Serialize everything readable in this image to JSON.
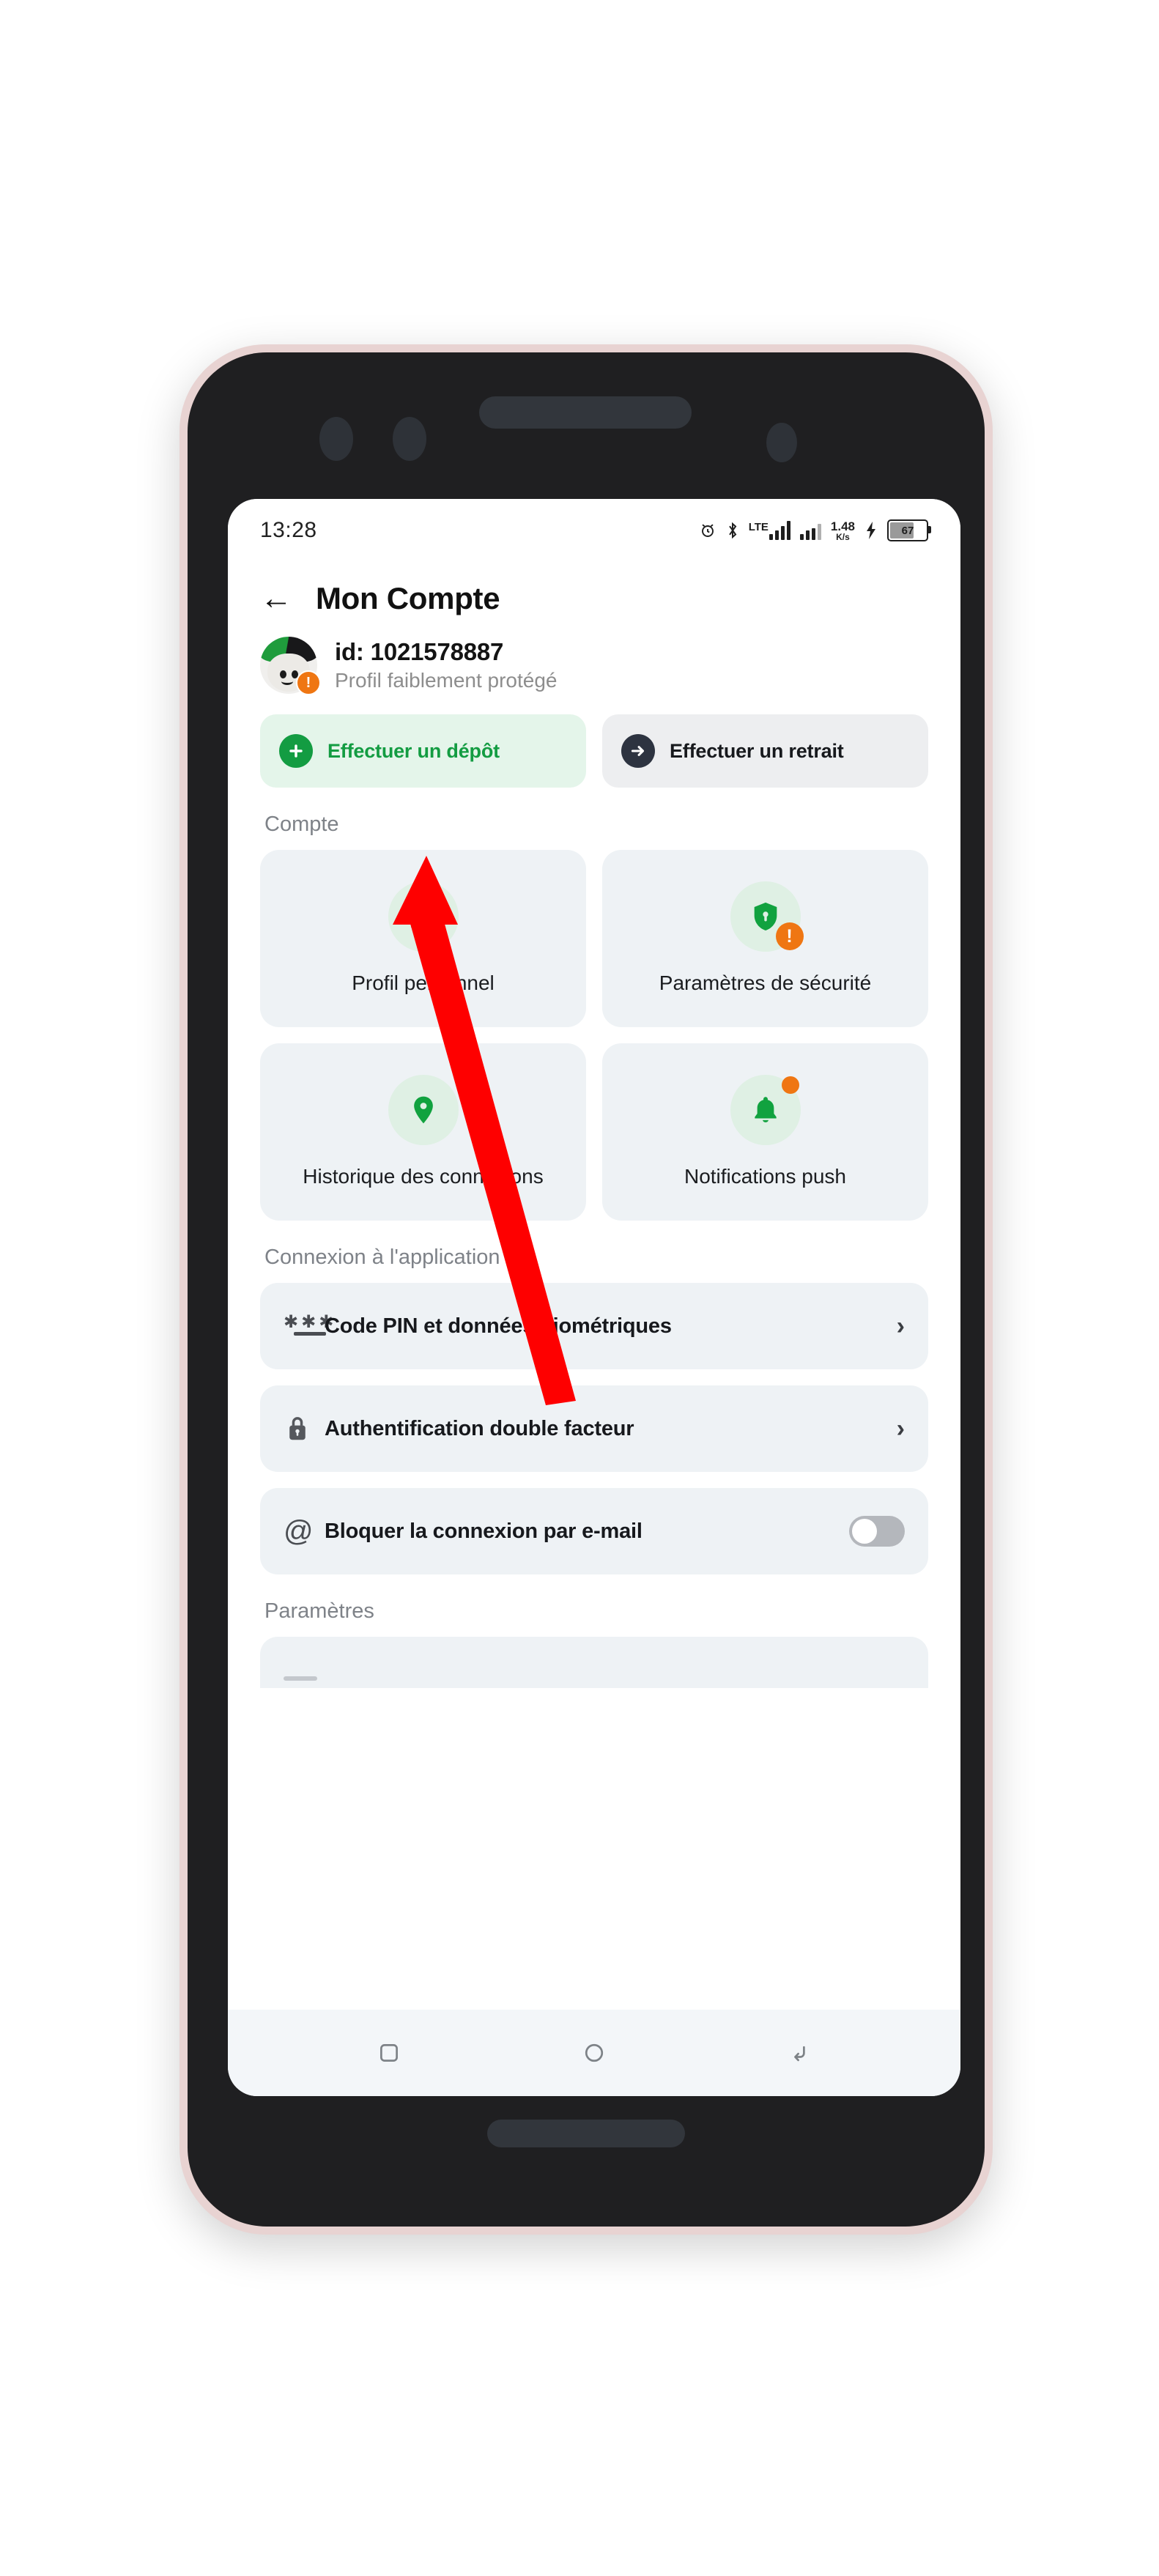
{
  "device": {
    "bezel_color": "#e8d3d2",
    "body_color": "#1f1f21",
    "power_button_color": "#f4743f"
  },
  "status_bar": {
    "time": "13:28",
    "icons": [
      "alarm-icon",
      "bluetooth-icon",
      "lte-signal-icon",
      "signal-icon",
      "network-speed",
      "charging-bolt-icon",
      "battery-icon"
    ],
    "lte_label": "LTE",
    "network_speed_value": "1.48",
    "network_speed_unit": "K/s",
    "battery_percent": "67"
  },
  "header": {
    "back_icon": "back-arrow-icon",
    "title": "Mon Compte"
  },
  "account": {
    "avatar_icon": "user-avatar",
    "warning_badge": "!",
    "id": "id: 1021578887",
    "status": "Profil faiblement protégé",
    "status_color": "#8d8d8d"
  },
  "actions": {
    "deposit": {
      "label": "Effectuer un dépôt",
      "icon": "plus-circle-icon",
      "bg": "#e4f5ea",
      "accent": "#139c42"
    },
    "withdraw": {
      "label": "Effectuer un retrait",
      "icon": "arrow-right-circle-icon",
      "bg": "#edeef0",
      "accent": "#2d3340"
    }
  },
  "sections": [
    {
      "title": "Compte"
    },
    {
      "title": "Connexion à l'application"
    },
    {
      "title": "Paramètres"
    }
  ],
  "account_tiles": [
    {
      "label": "Profil personnel",
      "icon": "person-edit-icon",
      "badge": null
    },
    {
      "label": "Paramètres de sécurité",
      "icon": "shield-lock-icon",
      "badge": "!"
    },
    {
      "label": "Historique des connexions",
      "icon": "location-pin-icon",
      "badge": null
    },
    {
      "label": "Notifications push",
      "icon": "bell-icon",
      "badge": "dot"
    }
  ],
  "login_rows": [
    {
      "label": "Code PIN et données biométriques",
      "icon": "pin-stars-icon",
      "control": "chevron",
      "chevron": "›"
    },
    {
      "label": "Authentification double facteur",
      "icon": "lock-icon",
      "control": "chevron",
      "chevron": "›"
    },
    {
      "label": "Bloquer la connexion par e-mail",
      "icon": "at-sign-icon",
      "control": "toggle",
      "toggle_on": false
    }
  ],
  "nav_bar": {
    "recents_icon": "square-recents-icon",
    "home_icon": "circle-home-icon",
    "back_icon": "back-nav-icon"
  },
  "annotation": {
    "arrow_color": "#fe0000",
    "points_to": "Effectuer un dépôt"
  }
}
